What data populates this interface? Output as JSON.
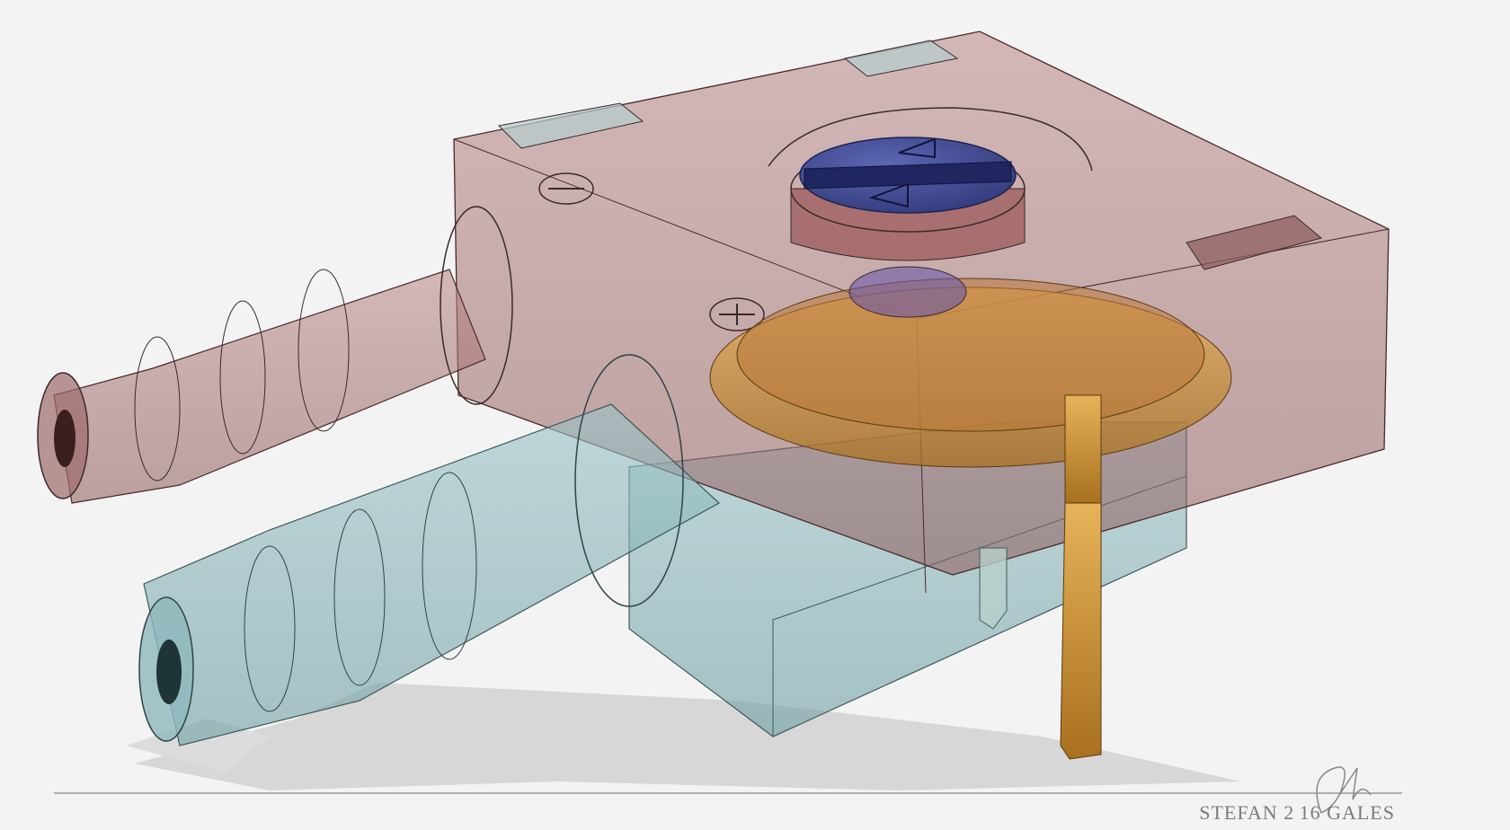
{
  "artwork": {
    "subject": "transparent-valve-block-render",
    "colors": {
      "background": "#f3f3f3",
      "upper_block": "#a86b6b",
      "lower_block": "#8fb8bc",
      "knob": "#3e4a8e",
      "brass": "#c48a2e",
      "shadow": "#d6d6d6",
      "outline": "#3a2a2a"
    }
  },
  "signature": {
    "text": "STEFAN 2016 GALES",
    "display_text": "STEFAN 2 16 GALES",
    "mark": "handwritten-initials"
  }
}
